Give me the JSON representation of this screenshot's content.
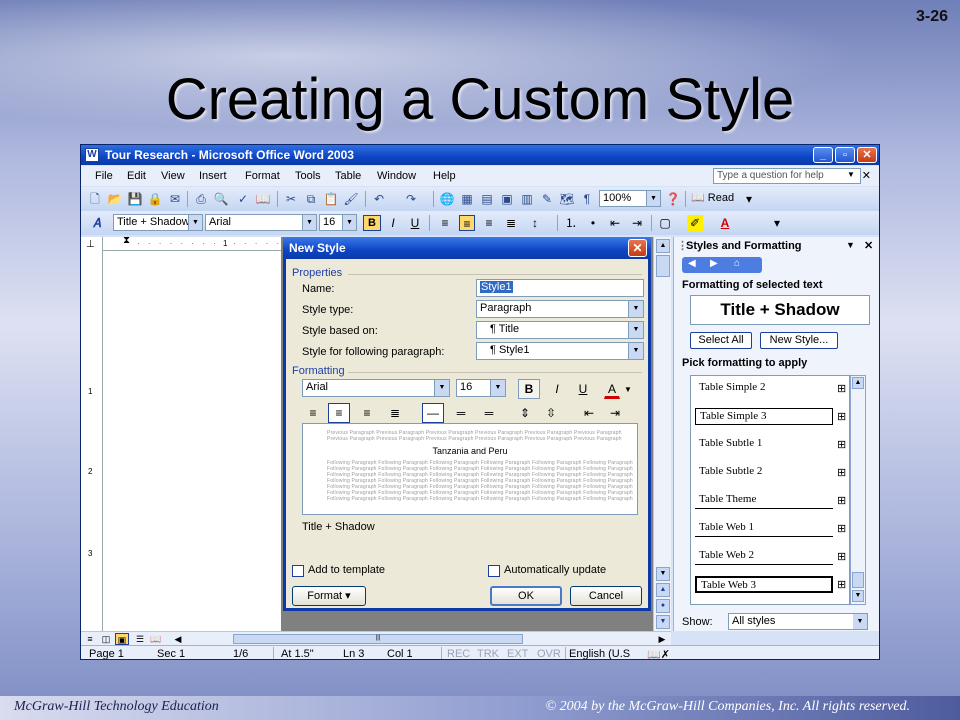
{
  "slide": {
    "number": "3-26",
    "title": "Creating a Custom Style",
    "footer_left": "McGraw-Hill Technology Education",
    "footer_right": "© 2004 by the McGraw-Hill Companies, Inc.  All rights reserved."
  },
  "window": {
    "title": "Tour Research - Microsoft Office Word 2003",
    "minimize": "_",
    "maximize": "▫",
    "close": "✕"
  },
  "menu": {
    "items": [
      "File",
      "Edit",
      "View",
      "Insert",
      "Format",
      "Tools",
      "Table",
      "Window",
      "Help"
    ],
    "help_placeholder": "Type a question for help"
  },
  "toolbar": {
    "zoom": "100%",
    "read_label": "Read",
    "style_combo": "Title + Shadow",
    "font_combo": "Arial",
    "size_combo": "16",
    "bold": "B",
    "italic": "I",
    "underline": "U"
  },
  "ruler": {
    "h_mark": "1",
    "v_marks": [
      "1",
      "2",
      "3"
    ]
  },
  "statusbar": {
    "page": "Page  1",
    "sec": "Sec  1",
    "pages": "1/6",
    "at": "At  1.5\"",
    "ln": "Ln  3",
    "col": "Col  1",
    "rec": "REC",
    "trk": "TRK",
    "ext": "EXT",
    "ovr": "OVR",
    "lang": "English (U.S"
  },
  "pane": {
    "title": "Styles and Formatting",
    "formatting_label": "Formatting of selected text",
    "selected_style": "Title + Shadow",
    "select_all": "Select All",
    "new_style": "New Style...",
    "pick_label": "Pick formatting to apply",
    "items": [
      {
        "label": "Table Simple 2",
        "mark": "⊞"
      },
      {
        "label": "Table Simple 3",
        "mark": "⊞"
      },
      {
        "label": "Table Subtle 1",
        "mark": "⊞"
      },
      {
        "label": "Table Subtle 2",
        "mark": "⊞"
      },
      {
        "label": "Table Theme",
        "mark": "⊞"
      },
      {
        "label": "Table Web 1",
        "mark": "⊞"
      },
      {
        "label": "Table Web 2",
        "mark": "⊞"
      },
      {
        "label": "Table Web 3",
        "mark": "⊞"
      }
    ],
    "show_label": "Show:",
    "show_value": "All styles"
  },
  "dialog": {
    "title": "New Style",
    "properties_label": "Properties",
    "name_label": "Name:",
    "name_value": "Style1",
    "type_label": "Style type:",
    "type_value": "Paragraph",
    "based_label": "Style based on:",
    "based_value": "¶ Title",
    "following_label": "Style for following paragraph:",
    "following_value": "¶ Style1",
    "formatting_label": "Formatting",
    "font_value": "Arial",
    "size_value": "16",
    "bold": "B",
    "italic": "I",
    "underline": "U",
    "color_glyph": "A",
    "preview_prev_1": "Previous Paragraph Previous Paragraph Previous Paragraph Previous Paragraph Previous Paragraph Previous Paragraph",
    "preview_prev_2": "Previous Paragraph Previous Paragraph Previous Paragraph Previous Paragraph Previous Paragraph Previous Paragraph",
    "preview_sample": "Tanzania and Peru",
    "preview_follow": "Following Paragraph Following Paragraph Following Paragraph Following Paragraph Following Paragraph Following Paragraph",
    "description": "Title + Shadow",
    "add_template": "Add to template",
    "auto_update": "Automatically update",
    "format_button": "Format ▾",
    "ok": "OK",
    "cancel": "Cancel"
  }
}
